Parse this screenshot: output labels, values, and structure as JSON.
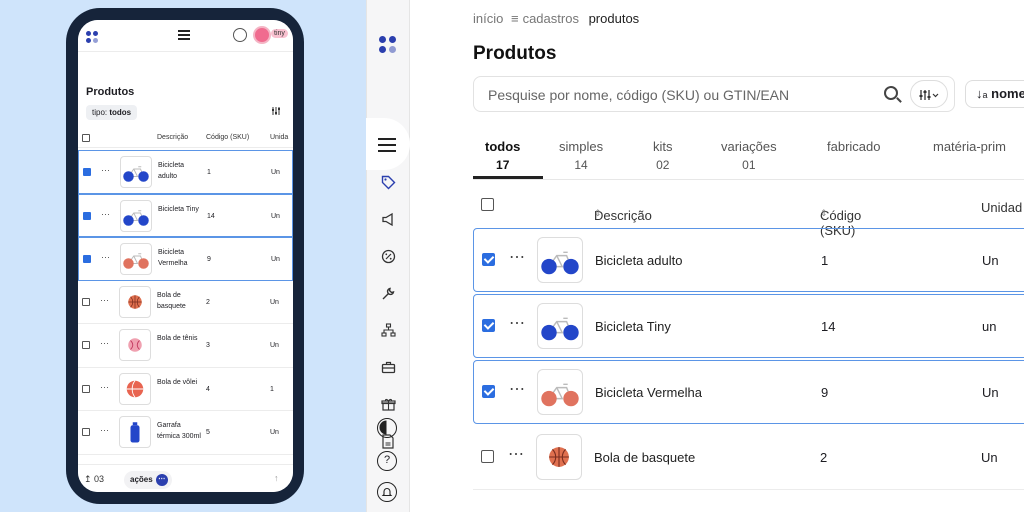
{
  "phone": {
    "avatar_label": "tiny",
    "title": "Produtos",
    "filter_prefix": "tipo:",
    "filter_value": "todos",
    "columns": {
      "description": "Descrição",
      "code": "Código (SKU)",
      "unit": "Unida"
    },
    "rows": [
      {
        "name": "Bicicleta adulto",
        "code": "1",
        "unit": "Un",
        "selected": true,
        "thumb": "bike-blue"
      },
      {
        "name": "Bicicleta Tiny",
        "code": "14",
        "unit": "Un",
        "selected": true,
        "thumb": "bike-blue"
      },
      {
        "name": "Bicicleta Vermelha",
        "code": "9",
        "unit": "Un",
        "selected": true,
        "thumb": "bike-red"
      },
      {
        "name": "Bola de basquete",
        "code": "2",
        "unit": "Un",
        "selected": false,
        "thumb": "basketball"
      },
      {
        "name": "Bola de tênis",
        "code": "3",
        "unit": "Un",
        "selected": false,
        "thumb": "tennis-ball"
      },
      {
        "name": "Bola de vôlei",
        "code": "4",
        "unit": "1",
        "selected": false,
        "thumb": "volleyball"
      },
      {
        "name": "Garrafa térmica 300ml",
        "code": "5",
        "unit": "Un",
        "selected": false,
        "thumb": "bottle"
      }
    ],
    "footer": {
      "selected_count": "03",
      "actions_label": "ações"
    }
  },
  "desktop": {
    "breadcrumb": {
      "home": "início",
      "cadastros": "cadastros",
      "current": "produtos"
    },
    "title": "Produtos",
    "search": {
      "placeholder": "Pesquise por nome, código (SKU) ou GTIN/EAN"
    },
    "sort_label": "nome",
    "tabs": [
      {
        "label": "todos",
        "count": "17",
        "active": true
      },
      {
        "label": "simples",
        "count": "14"
      },
      {
        "label": "kits",
        "count": "02"
      },
      {
        "label": "variações",
        "count": "01"
      },
      {
        "label": "fabricado",
        "count": ""
      },
      {
        "label": "matéria-prim",
        "count": ""
      }
    ],
    "columns": {
      "description": "Descrição",
      "code": "Código (SKU)",
      "unit": "Unidad"
    },
    "rows": [
      {
        "name": "Bicicleta adulto",
        "code": "1",
        "unit": "Un",
        "selected": true,
        "thumb": "bike-blue"
      },
      {
        "name": "Bicicleta Tiny",
        "code": "14",
        "unit": "un",
        "selected": true,
        "thumb": "bike-blue"
      },
      {
        "name": "Bicicleta Vermelha",
        "code": "9",
        "unit": "Un",
        "selected": true,
        "thumb": "bike-red"
      },
      {
        "name": "Bola de basquete",
        "code": "2",
        "unit": "Un",
        "selected": false,
        "thumb": "basketball"
      }
    ]
  },
  "colors": {
    "brand": "#2b3fae",
    "accent": "#2b6de0",
    "selected_border": "#5b95e6",
    "background_blue": "#cfe4fb"
  },
  "icons": [
    "menu-icon",
    "user-icon",
    "tag-icon",
    "megaphone-icon",
    "percent-icon",
    "wrench-icon",
    "hierarchy-icon",
    "briefcase-icon",
    "gift-icon",
    "document-icon",
    "contrast-icon",
    "help-icon",
    "bell-icon"
  ]
}
